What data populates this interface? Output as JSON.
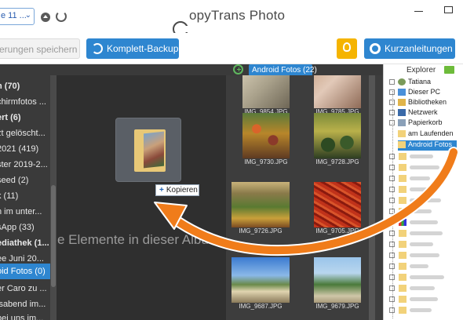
{
  "titlebar": {
    "device_label": "e 11 ...",
    "app_title": "opyTrans Photo"
  },
  "toolbar": {
    "save_label": "erungen speichern",
    "backup_label": "Komplett-Backup",
    "guides_label": "Kurzanleitungen"
  },
  "albums": [
    {
      "label": "n (70)",
      "bold": true
    },
    {
      "label": "chirmfotos ...",
      "bold": false
    },
    {
      "label": "ert (6)",
      "bold": true
    },
    {
      "label": "zt gelöscht...",
      "bold": false
    },
    {
      "label": " 2021 (419)",
      "bold": false
    },
    {
      "label": "ster 2019-2...",
      "bold": false
    },
    {
      "label": "seed (2)",
      "bold": false
    },
    {
      "label": "k (11)",
      "bold": false
    },
    {
      "label": "n im unter...",
      "bold": false
    },
    {
      "label": "sApp (33)",
      "bold": false
    },
    {
      "label": "ediathek (1...",
      "bold": true
    },
    {
      "label": "ee Juni 20...",
      "bold": false
    },
    {
      "label": "oid Fotos (0)",
      "bold": false,
      "selected": true
    },
    {
      "label": "er Caro zu ...",
      "bold": false
    },
    {
      "label": "lsabend im...",
      "bold": false
    },
    {
      "label": " bei uns im...",
      "bold": false
    }
  ],
  "drop_area": {
    "message": "e Elemente in dieser Album",
    "copy_tooltip": "Kopieren"
  },
  "device_panel": {
    "tab_label": "Android Fotos (22)"
  },
  "photos": [
    {
      "caption": "IMG_9854.JPG"
    },
    {
      "caption": "IMG_9785.JPG"
    },
    {
      "caption": "IMG_9730.JPG"
    },
    {
      "caption": "IMG_9728.JPG"
    },
    {
      "caption": "IMG_9726.JPG"
    },
    {
      "caption": "IMG_9705.JPG"
    },
    {
      "caption": "IMG_9687.JPG"
    },
    {
      "caption": "IMG_9679.JPG"
    }
  ],
  "explorer": {
    "title": "Explorer",
    "items": [
      {
        "label": "Tatiana",
        "icon": "user-icon"
      },
      {
        "label": "Dieser PC",
        "icon": "computer-icon"
      },
      {
        "label": "Bibliotheken",
        "icon": "library-icon"
      },
      {
        "label": "Netzwerk",
        "icon": "network-icon"
      },
      {
        "label": "Papierkorb",
        "icon": "recycle-bin-icon"
      },
      {
        "label": "am Laufenden",
        "icon": "folder-icon"
      },
      {
        "label": "Android Fotos",
        "icon": "folder-icon",
        "selected": true
      }
    ]
  },
  "colors": {
    "accent": "#2e86d0",
    "arrow": "#f07c1a",
    "dark_panel": "#2f2f2f"
  }
}
